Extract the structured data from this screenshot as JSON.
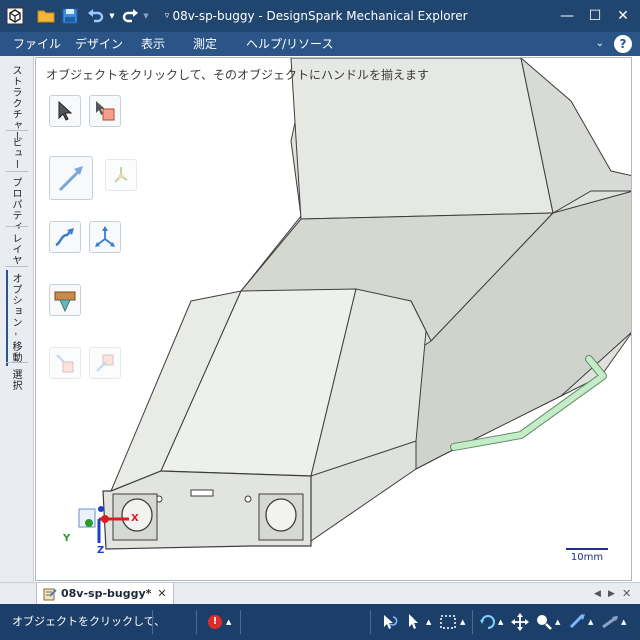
{
  "window": {
    "title": "08v-sp-buggy - DesignSpark Mechanical Explorer",
    "controls": {
      "minimize": "—",
      "maximize": "☐",
      "close": "✕"
    }
  },
  "menu": {
    "items": [
      "ファイル",
      "デザイン",
      "表示",
      "測定",
      "ヘルプ/リソース"
    ],
    "help_glyph": "?",
    "collapse_glyph": "⌄"
  },
  "side_tabs": [
    "ストラクチャー",
    "ビュー",
    "プロパティ",
    "レイヤ",
    "オプション - 移動",
    "選択"
  ],
  "viewport": {
    "hint": "オブジェクトをクリックして、そのオブジェクトにハンドルを揃えます",
    "scale_label": "10mm",
    "axis_labels": {
      "x": "X",
      "y": "Y",
      "z": "Z"
    },
    "tools": [
      "select-arrow-tool",
      "select-component-tool",
      "move-along-trajectory-tool",
      "anchor-tool",
      "move-along-path-tool",
      "pull-handle-tool",
      "ruler-dimension-tool",
      "disabled-tool-a",
      "disabled-tool-b"
    ]
  },
  "document_tabs": {
    "active": {
      "label": "08v-sp-buggy*",
      "close": "✕"
    },
    "nav_prev": "◀",
    "nav_next": "▶"
  },
  "status": {
    "text": "オブジェクトをクリックして、",
    "error_glyph": "!",
    "icons": [
      "undo-select-icon",
      "pointer-icon",
      "box-select-icon",
      "rotate-icon",
      "pan-icon",
      "zoom-icon",
      "spin-icon",
      "fly-icon"
    ]
  },
  "colors": {
    "title_bar": "#20466f",
    "menu_bar": "#2b5587",
    "status_bar": "#1c3f6a",
    "model_face": "#e3e6e0",
    "model_edge": "#3d3d3d",
    "rod": "#bfe7c4"
  }
}
